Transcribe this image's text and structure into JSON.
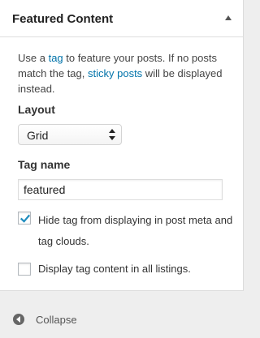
{
  "header": {
    "title": "Featured Content"
  },
  "description": {
    "part1": "Use a ",
    "tag_link": "tag",
    "part2": " to feature your posts. If no posts match the tag, ",
    "sticky_link": "sticky posts",
    "part3": " will be displayed instead."
  },
  "layout": {
    "label": "Layout",
    "selected": "Grid"
  },
  "tag_name": {
    "label": "Tag name",
    "value": "featured"
  },
  "options": [
    {
      "label": "Hide tag from displaying in post meta and tag clouds.",
      "checked": true
    },
    {
      "label": "Display tag content in all listings.",
      "checked": false
    }
  ],
  "footer": {
    "collapse_label": "Collapse"
  },
  "colors": {
    "link": "#0073aa",
    "check": "#1e8cbe"
  }
}
